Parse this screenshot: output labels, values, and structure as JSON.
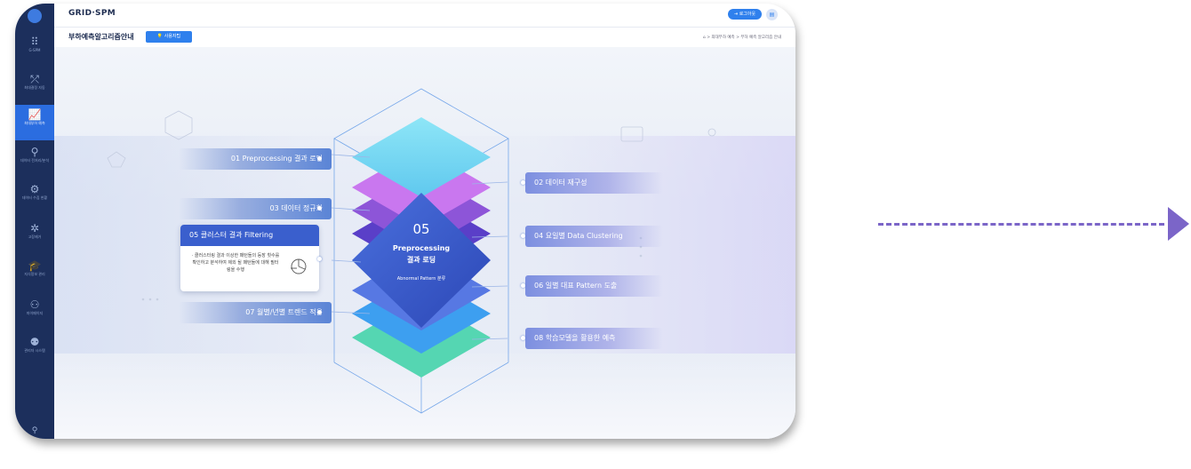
{
  "topbar": {
    "brand": "GRID·SPM",
    "logout_label": "로그아웃",
    "extra_icon": "document-icon"
  },
  "subbar": {
    "page_title": "부하예측알고리즘안내",
    "manual_label": "사용자팁",
    "breadcrumb": "⌂ > 최대부하 예측 > 부하 예측 알고리즘 안내"
  },
  "sidebar": {
    "items": [
      {
        "icon": "grid-icon",
        "label": "G-SPM"
      },
      {
        "icon": "chart-icon",
        "label": "최대결정 자동"
      },
      {
        "icon": "trend-icon",
        "label": "최대부하 예측"
      },
      {
        "icon": "analysis-icon",
        "label": "데이터 전처리/분석"
      },
      {
        "icon": "collect-icon",
        "label": "데이터 수집 현황"
      },
      {
        "icon": "gear-icon",
        "label": "고장제거"
      },
      {
        "icon": "learn-icon",
        "label": "지식정보 관리"
      },
      {
        "icon": "user-icon",
        "label": "마이페이지"
      },
      {
        "icon": "admin-icon",
        "label": "관리자 시스템"
      }
    ]
  },
  "center": {
    "number": "05",
    "title_line1": "Preprocessing",
    "title_line2": "결과 로딩",
    "subtitle": "Abnormal Pattern 분류"
  },
  "steps_left": [
    {
      "label": "01  Preprocessing 결과 로딩"
    },
    {
      "label": "03  데이터 정규화"
    },
    {
      "label": "07  월별/년별 트렌드 적용"
    }
  ],
  "steps_right": [
    {
      "label": "02  데이터 재구성"
    },
    {
      "label": "04  요일별 Data Clustering"
    },
    {
      "label": "06  일별 대표 Pattern 도출"
    },
    {
      "label": "08  학습모델을 활용한 예측"
    }
  ],
  "detail_card": {
    "title": "05  클러스터 결과 Filtering",
    "body": "· 클러스터링 결과 이상한 패턴들의 등장 횟수를 확인하고 분석하여 제외 될 패턴들에 대해 필터링을 수행"
  },
  "colors": {
    "accent": "#2f80ed",
    "sidebar": "#1c2f5c",
    "arrow": "#7b65c8"
  }
}
